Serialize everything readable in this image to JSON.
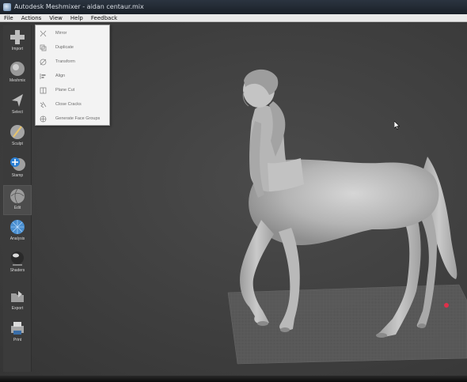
{
  "window": {
    "title": "Autodesk Meshmixer - aidan centaur.mix"
  },
  "menu": [
    "File",
    "Actions",
    "View",
    "Help",
    "Feedback"
  ],
  "tools": [
    {
      "label": "Import",
      "icon": "plus-icon"
    },
    {
      "label": "Meshmix",
      "icon": "meshmix-sphere-icon"
    },
    {
      "label": "Select",
      "icon": "select-arrow-icon"
    },
    {
      "label": "Sculpt",
      "icon": "sculpt-brush-icon"
    },
    {
      "label": "Stamp",
      "icon": "stamp-icon"
    },
    {
      "label": "Edit",
      "icon": "edit-sphere-icon",
      "active": true
    },
    {
      "label": "Analysis",
      "icon": "analysis-sphere-icon"
    },
    {
      "label": "Shaders",
      "icon": "shaders-sphere-icon"
    },
    {
      "label": "Export",
      "icon": "export-folder-icon"
    },
    {
      "label": "Print",
      "icon": "printer-icon"
    }
  ],
  "edit_menu": [
    {
      "label": "Mirror",
      "icon": "mirror-icon"
    },
    {
      "label": "Duplicate",
      "icon": "duplicate-icon"
    },
    {
      "label": "Transform",
      "icon": "transform-icon"
    },
    {
      "label": "Align",
      "icon": "align-icon"
    },
    {
      "label": "Plane Cut",
      "icon": "plane-cut-icon"
    },
    {
      "label": "Close Cracks",
      "icon": "close-cracks-icon"
    },
    {
      "label": "Generate Face Groups",
      "icon": "face-groups-icon"
    }
  ],
  "colors": {
    "viewport_bg": "#434343",
    "model": "#bdbdbd",
    "marker": "#e0304a"
  }
}
